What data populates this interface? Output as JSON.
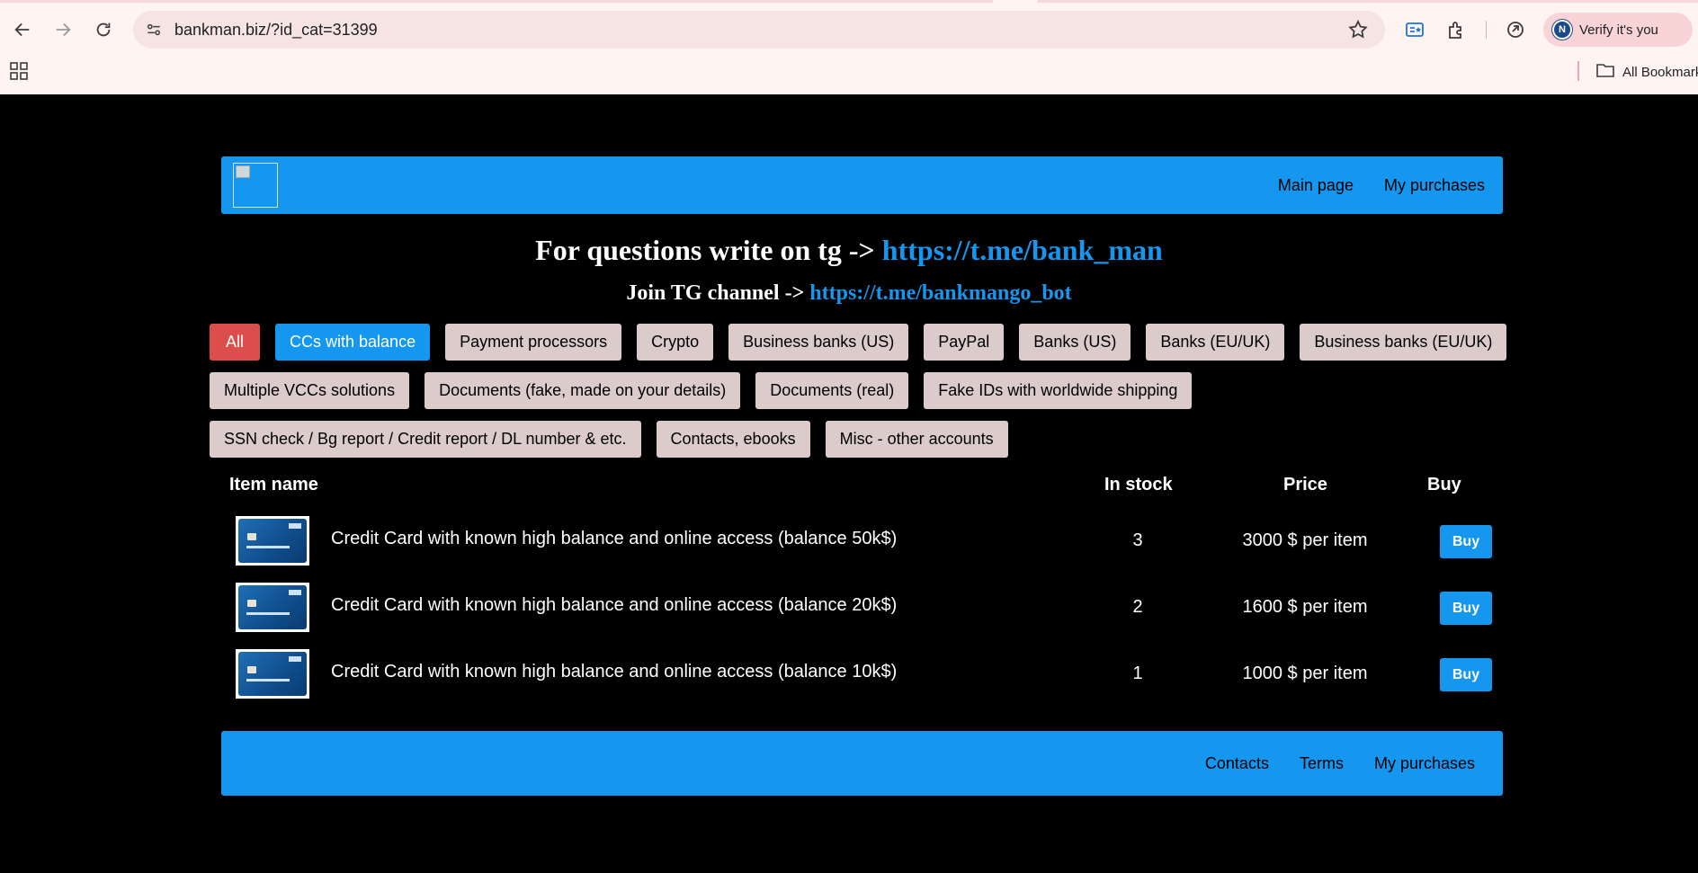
{
  "browser": {
    "url": "bankman.biz/?id_cat=31399",
    "profile_initial": "N",
    "verify_label": "Verify it's you",
    "bookmarks_label": "All Bookmarks",
    "icons": [
      "back-icon",
      "forward-icon",
      "reload-icon",
      "site-info-icon",
      "star-icon",
      "reading-mode-icon",
      "extensions-icon",
      "copilot-icon",
      "apps-icon",
      "folder-icon"
    ]
  },
  "header": {
    "nav": [
      {
        "label": "Main page"
      },
      {
        "label": "My purchases"
      }
    ]
  },
  "info": {
    "line1_text": "For questions write on tg -> ",
    "line1_link": "https://t.me/bank_man",
    "line2_text": "Join TG channel -> ",
    "line2_link": "https://t.me/bankmango_bot"
  },
  "categories": {
    "row1": [
      "All",
      "CCs with balance",
      "Payment processors",
      "Crypto",
      "Business banks (US)",
      "PayPal",
      "Banks (US)",
      "Banks (EU/UK)",
      "Business banks (EU/UK)"
    ],
    "row2": [
      "Multiple VCCs solutions",
      "Documents (fake, made on your details)",
      "Documents (real)",
      "Fake IDs with worldwide shipping"
    ],
    "row3": [
      "SSN check / Bg report / Credit report / DL number & etc.",
      "Contacts, ebooks",
      "Misc - other accounts"
    ],
    "active": "CCs with balance"
  },
  "table": {
    "headers": {
      "name": "Item name",
      "stock": "In stock",
      "price": "Price",
      "buy": "Buy"
    },
    "rows": [
      {
        "name": "Credit Card with known high balance and online access (balance 50k$)",
        "stock": "3",
        "price": "3000 $ per item",
        "buy": "Buy"
      },
      {
        "name": "Credit Card with known high balance and online access (balance 20k$)",
        "stock": "2",
        "price": "1600 $ per item",
        "buy": "Buy"
      },
      {
        "name": "Credit Card with known high balance and online access (balance 10k$)",
        "stock": "1",
        "price": "1000 $ per item",
        "buy": "Buy"
      }
    ]
  },
  "footer": {
    "nav": [
      {
        "label": "Contacts"
      },
      {
        "label": "Terms"
      },
      {
        "label": "My purchases"
      }
    ]
  },
  "colors": {
    "accent": "#1597f0",
    "all_button": "#dc4e4c",
    "category_button": "#dccbcb",
    "background": "#000000"
  }
}
